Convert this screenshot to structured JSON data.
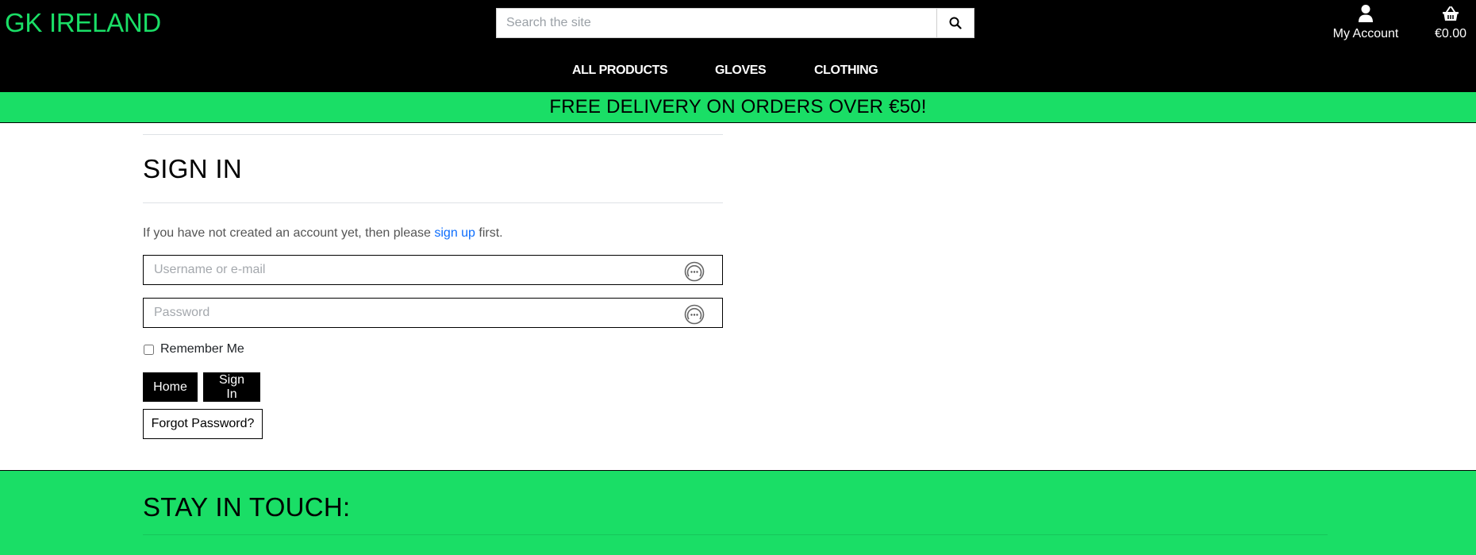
{
  "header": {
    "brand": "GK IRELAND",
    "search_placeholder": "Search the site",
    "account_label": "My Account",
    "bag_total": "€0.00"
  },
  "nav": {
    "items": [
      {
        "label": "ALL PRODUCTS"
      },
      {
        "label": "GLOVES"
      },
      {
        "label": "CLOTHING"
      }
    ]
  },
  "banner": {
    "text": "FREE DELIVERY ON ORDERS OVER €50!"
  },
  "signin": {
    "title": "SIGN IN",
    "intro_before": "If you have not created an account yet, then please ",
    "intro_link": "sign up",
    "intro_after": " first.",
    "username_placeholder": "Username or e-mail",
    "password_placeholder": "Password",
    "remember_label": "Remember Me",
    "home_button": "Home",
    "signin_button": "Sign In",
    "forgot_button": "Forgot Password?"
  },
  "footer": {
    "title": "STAY IN TOUCH:"
  },
  "colors": {
    "brand_green": "#1ade66",
    "header_bg": "#000000",
    "link_blue": "#0d6efd"
  }
}
